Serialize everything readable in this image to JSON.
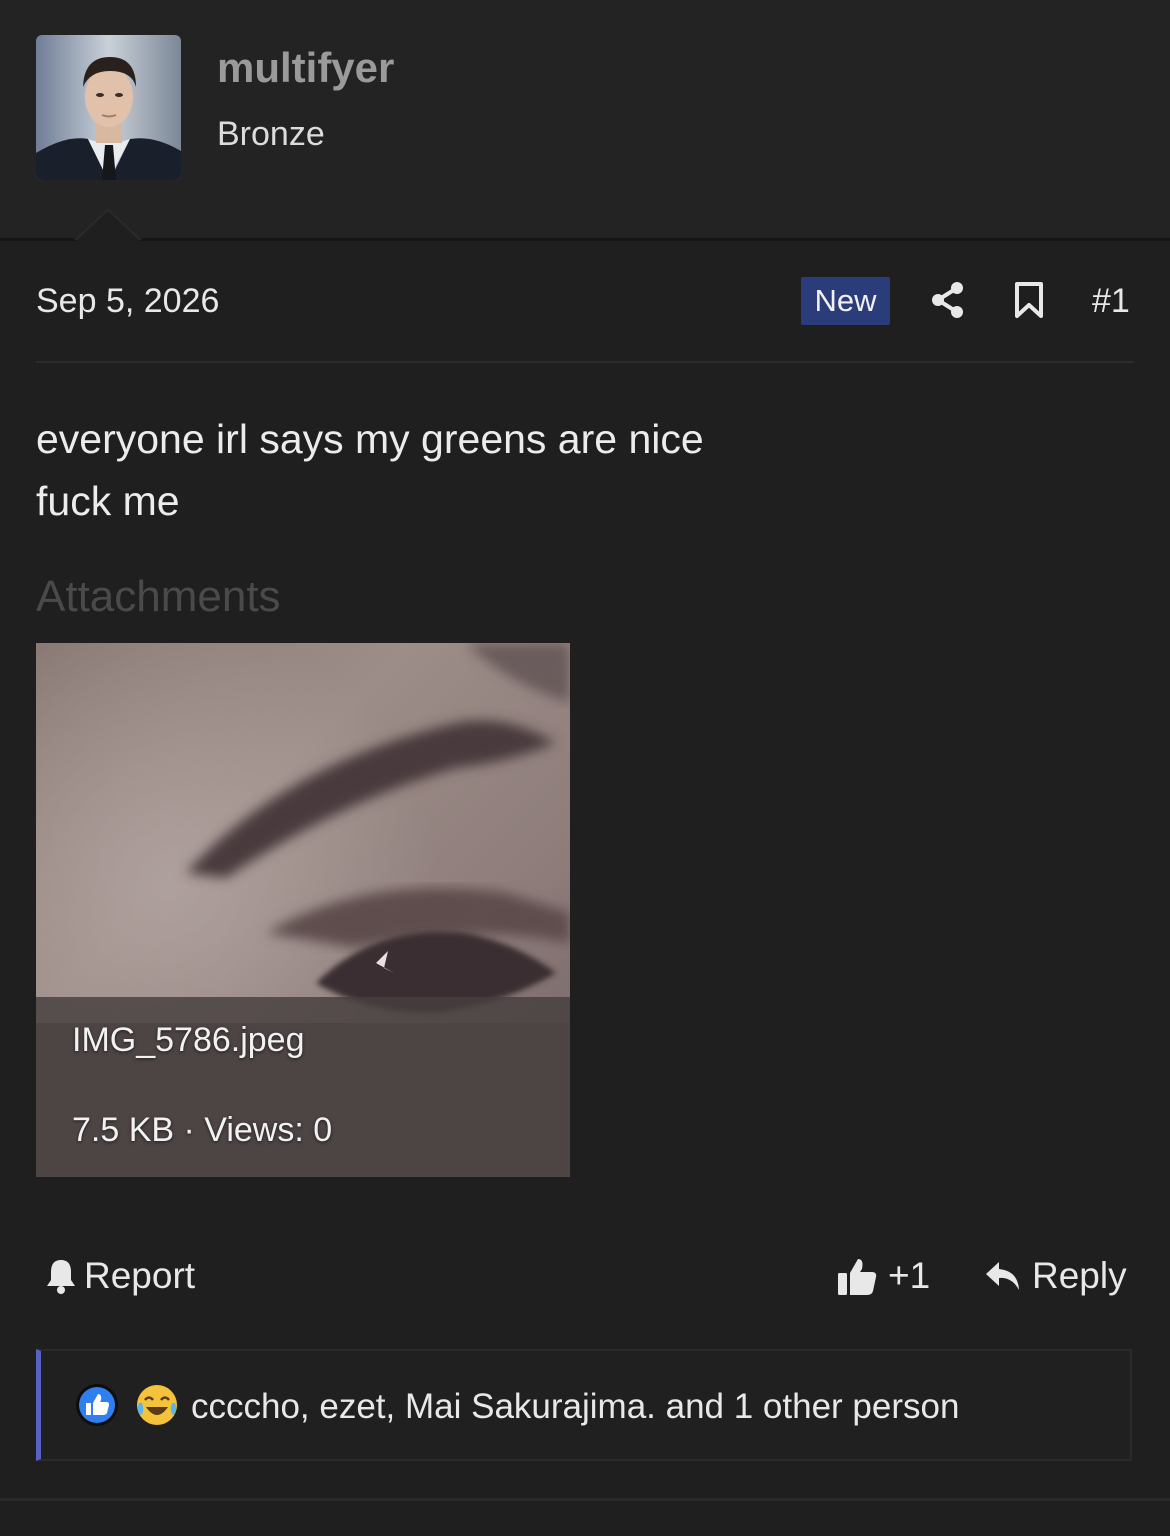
{
  "user": {
    "name": "multifyer",
    "title": "Bronze"
  },
  "post": {
    "date": "Sep 5, 2026",
    "badge": "New",
    "number": "#1",
    "body_lines": [
      "everyone irl says my greens are nice",
      "fuck me"
    ]
  },
  "attachments": {
    "heading": "Attachments",
    "items": [
      {
        "filename": "IMG_5786.jpeg",
        "meta": "7.5 KB · Views: 0"
      }
    ]
  },
  "actions": {
    "report_label": "Report",
    "like_count": "+1",
    "reply_label": "Reply"
  },
  "reactions": {
    "icons": [
      "like-icon",
      "laugh-icon"
    ],
    "text": "ccccho, ezet, Mai Sakurajima. and 1 other person"
  },
  "colors": {
    "background": "#1f1f20",
    "header_background": "#232324",
    "badge": "#2b3c7a",
    "reaction_accent": "#5a61c4",
    "username": "#9a9a9a"
  }
}
